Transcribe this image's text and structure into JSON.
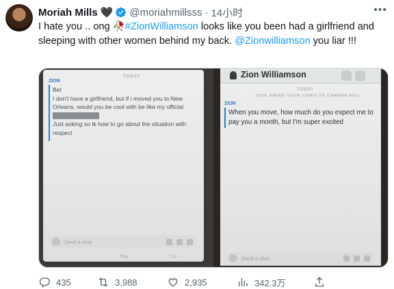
{
  "author": {
    "name": "Moriah Mills",
    "heart": "🖤",
    "handle": "@moriahmillsss",
    "time": "14小时",
    "avatar_icon": "avatar-photo"
  },
  "tweet": {
    "part1": "I hate you .. ong ",
    "rose": "🥀",
    "hashtag": "#ZionWilliamson",
    "part2": " looks like you been had a girlfriend and sleeping with other women behind my back. ",
    "mention": "@Zionwilliamson",
    "part3": " you liar !!!"
  },
  "media": {
    "left": {
      "today": "TODAY",
      "sender": "ZION",
      "lines": [
        "Bet",
        "I don't have a girlfriend, but if i moved you to New",
        "Orleans, would you be cool with be like my official",
        "Just asking so lk how to go about the situation with",
        "respect"
      ],
      "chat_placeholder": "Send a chat",
      "keyboard_left": "The",
      "keyboard_right": "I'm"
    },
    "right": {
      "contact": "Zion Williamson",
      "today": "TODAY",
      "notice": "ZION SAVED YOUR VIDEO TO CAMERA ROLL",
      "sender": "ZION",
      "lines": [
        "When you move, how much do you expect me to",
        "pay you a month, but I'm super excited"
      ],
      "chat_placeholder": "Send a chat"
    }
  },
  "actions": {
    "replies": "435",
    "retweets": "3,988",
    "likes": "2,935",
    "views": "342.3万"
  },
  "colors": {
    "accent": "#1d9bf0",
    "muted": "#536471",
    "verified": "#1d9bf0"
  }
}
